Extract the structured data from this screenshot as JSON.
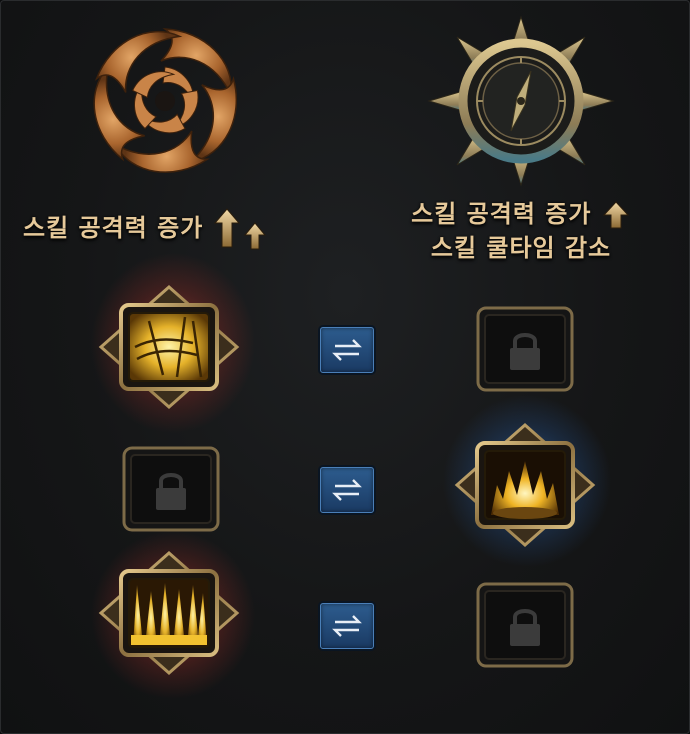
{
  "left_column": {
    "title": "스킬 공격력 증가",
    "emblem_icon": "swirl-emblem-icon",
    "accent": "#b8743a"
  },
  "right_column": {
    "title_line1": "스킬 공격력 증가",
    "title_line2": "스킬 쿨타임 감소",
    "emblem_icon": "compass-emblem-icon",
    "accent": "#c9b584"
  },
  "rows": [
    {
      "left": {
        "state": "active",
        "icon": "golden-slash-skill-icon",
        "aura": "#c8473a"
      },
      "swap_icon": "swap-arrows-icon",
      "right": {
        "state": "locked",
        "icon": "padlock-icon"
      }
    },
    {
      "left": {
        "state": "locked",
        "icon": "padlock-icon"
      },
      "swap_icon": "swap-arrows-icon",
      "right": {
        "state": "active",
        "icon": "golden-flame-burst-skill-icon",
        "aura": "#3b7fd1"
      }
    },
    {
      "left": {
        "state": "active",
        "icon": "golden-fire-pillars-skill-icon",
        "aura": "#c8473a"
      },
      "swap_icon": "swap-arrows-icon",
      "right": {
        "state": "locked",
        "icon": "padlock-icon"
      }
    }
  ],
  "colors": {
    "title": "#e6c99a",
    "swap_button": "#2d5c8e",
    "frame_gold": "#b59a63"
  }
}
